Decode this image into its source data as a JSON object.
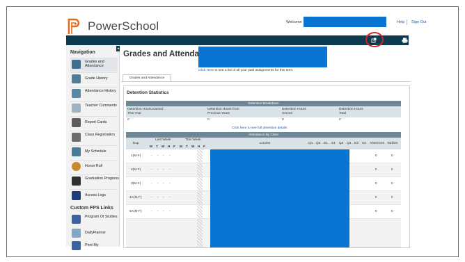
{
  "app": {
    "name": "PowerSchool"
  },
  "header": {
    "welcome_label": "Welcome",
    "help_label": "Help",
    "signout_label": "Sign Out"
  },
  "nav": {
    "title": "Navigation",
    "items": [
      {
        "label": "Grades and Attendance"
      },
      {
        "label": "Grade History"
      },
      {
        "label": "Attendance History"
      },
      {
        "label": "Teacher Comments"
      },
      {
        "label": "Report Cards"
      },
      {
        "label": "Class Registration"
      },
      {
        "label": "My Schedule"
      },
      {
        "label": "Honor Roll"
      },
      {
        "label": "Graduation Progress"
      },
      {
        "label": "Access Logs"
      }
    ],
    "custom_title": "Custom FPS Links",
    "custom_items": [
      {
        "label": "Program Of Studies"
      },
      {
        "label": "DailyPlanner"
      },
      {
        "label": "Print My"
      }
    ]
  },
  "main": {
    "title": "Grades and Attendance:",
    "assign_link": "Click Here",
    "assign_rest": "to see a list of all your past assignments for this term.",
    "tab_label": "Grades and Attendance"
  },
  "detention": {
    "title": "Detention Statistics",
    "breakdown_label": "Detention Breakdown",
    "columns": [
      {
        "line1": "Detention Hours Earned",
        "line2": "This Year"
      },
      {
        "line1": "Detention Hours from",
        "line2": "Previous Years"
      },
      {
        "line1": "Detention Hours",
        "line2": "Served"
      },
      {
        "line1": "Detention Hours",
        "line2": "Total"
      }
    ],
    "values": [
      "0",
      "0",
      "0",
      "0"
    ],
    "details_link": "Click here to see full detention details"
  },
  "attendance": {
    "header": "Attendance By Class",
    "exp_label": "Exp",
    "last_week_label": "Last Week",
    "this_week_label": "This Week",
    "course_label": "Course",
    "days": [
      "M",
      "T",
      "W",
      "H",
      "F"
    ],
    "terms": [
      "Q1",
      "Q2",
      "E1",
      "S1",
      "Q3",
      "Q4",
      "E2",
      "S2"
    ],
    "absences_label": "Absences",
    "tardies_label": "Tardies",
    "rows": [
      {
        "exp": "1(M-F)",
        "days": [
          "-",
          "-",
          "-",
          "-"
        ],
        "absences": "0",
        "tardies": "0"
      },
      {
        "exp": "2(M-F)",
        "days": [
          "-",
          "-",
          "-",
          "-"
        ],
        "absences": "0",
        "tardies": "0"
      },
      {
        "exp": "3(M-F)",
        "days": [
          "-",
          "-",
          "-",
          "-"
        ],
        "absences": "0",
        "tardies": "0"
      },
      {
        "exp": "4A(M-F)",
        "days": [
          "-",
          "-",
          "-",
          "-"
        ],
        "absences": "0",
        "tardies": "0"
      },
      {
        "exp": "5A(M-F)",
        "days": [
          "-",
          "-",
          "-",
          "-"
        ],
        "absences": "0",
        "tardies": "0"
      }
    ]
  },
  "colors": {
    "topbar": "#0e3a4f",
    "table_header": "#6d8796",
    "redaction": "#0a74d2",
    "highlight_circle": "#d32222"
  },
  "icons": {
    "external_link": "external-link-icon",
    "print": "printer-icon"
  }
}
